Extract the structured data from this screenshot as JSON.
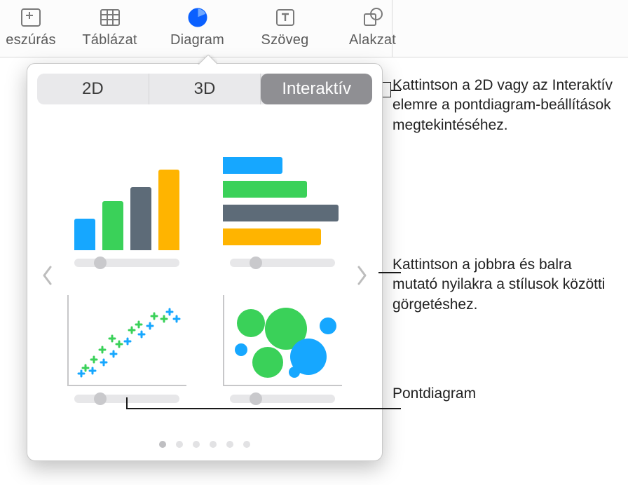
{
  "toolbar": {
    "items": [
      {
        "label": "eszúrás",
        "icon": "insert-icon"
      },
      {
        "label": "Táblázat",
        "icon": "table-icon"
      },
      {
        "label": "Diagram",
        "icon": "chart-icon",
        "selected": true
      },
      {
        "label": "Szöveg",
        "icon": "text-icon"
      },
      {
        "label": "Alakzat",
        "icon": "shape-icon"
      }
    ]
  },
  "popover": {
    "tabs": {
      "t2d": "2D",
      "t3d": "3D",
      "tinteractive": "Interaktív",
      "active": "Interaktív"
    },
    "charts": {
      "bar": "interactive-column-chart",
      "hbar": "interactive-bar-chart",
      "scatter": "interactive-scatter-chart",
      "bubble": "interactive-bubble-chart"
    },
    "page_count": 6,
    "page_active": 0
  },
  "callouts": {
    "c1": "Kattintson a 2D vagy az Interaktív elemre a pontdiagram-beállítások megtekintéséhez.",
    "c2": "Kattintson a jobbra és balra mutató nyilakra a stílusok közötti görgetéshez.",
    "c3": "Pontdiagram"
  },
  "colors": {
    "blue": "#16a7ff",
    "green": "#3ad159",
    "slate": "#5d6b78",
    "amber": "#ffb400"
  }
}
